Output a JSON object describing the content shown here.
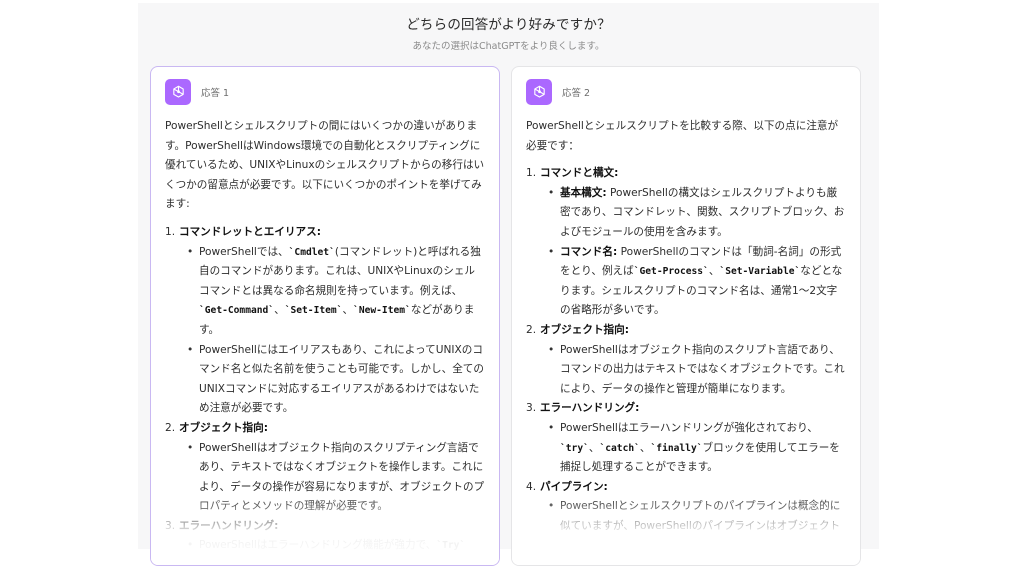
{
  "header": {
    "question": "どちらの回答がより好みですか？",
    "subtitle": "あなたの選択はChatGPTをより良くします。"
  },
  "icons": {
    "logo": "openai-logo-icon",
    "logo_bg": "#ab68ff"
  },
  "response1": {
    "label": "応答 1",
    "intro": "PowerShellとシェルスクリプトの間にはいくつかの違いがあります。PowerShellはWindows環境での自動化とスクリプティングに優れているため、UNIXやLinuxのシェルスクリプトからの移行はいくつかの留意点が必要です。以下にいくつかのポイントを挙げてみます:",
    "s1": {
      "num": "1.",
      "title": "コマンドレットとエイリアス:",
      "b1": {
        "t1": "PowerShellでは、",
        "c1": "`Cmdlet`",
        "t2": "(コマンドレット)と呼ばれる独自のコマンドがあります。これは、UNIXやLinuxのシェルコマンドとは異なる命名規則を持っています。例えば、",
        "c2": "`Get-Command`",
        "t3": "、",
        "c3": "`Set-Item`",
        "t4": "、",
        "c4": "`New-Item`",
        "t5": "などがあります。"
      },
      "b2": "PowerShellにはエイリアスもあり、これによってUNIXのコマンド名と似た名前を使うことも可能です。しかし、全てのUNIXコマンドに対応するエイリアスがあるわけではないため注意が必要です。"
    },
    "s2": {
      "num": "2.",
      "title": "オブジェクト指向:",
      "b1": "PowerShellはオブジェクト指向のスクリプティング言語であり、テキストではなくオブジェクトを操作します。これにより、データの操作が容易になりますが、オブジェクトのプロパティとメソッドの理解が必要です。"
    },
    "s3": {
      "num": "3.",
      "title": "エラーハンドリング:",
      "b1": {
        "t1": "PowerShellはエラーハンドリング機能が強力で、",
        "c1": "`Try`"
      }
    }
  },
  "response2": {
    "label": "応答 2",
    "intro": "PowerShellとシェルスクリプトを比較する際、以下の点に注意が必要です：",
    "s1": {
      "num": "1.",
      "title": "コマンドと構文:",
      "b1": {
        "k": "基本構文:",
        "t": " PowerShellの構文はシェルスクリプトよりも厳密であり、コマンドレット、関数、スクリプトブロック、およびモジュールの使用を含みます。"
      },
      "b2": {
        "k": "コマンド名:",
        "t1": " PowerShellのコマンドは「動詞-名詞」の形式をとり、例えば",
        "c1": "`Get-Process`",
        "t2": "、",
        "c2": "`Set-Variable`",
        "t3": "などとなります。シェルスクリプトのコマンド名は、通常1〜2文字の省略形が多いです。"
      }
    },
    "s2": {
      "num": "2.",
      "title": "オブジェクト指向:",
      "b1": "PowerShellはオブジェクト指向のスクリプト言語であり、コマンドの出力はテキストではなくオブジェクトです。これにより、データの操作と管理が簡単になります。"
    },
    "s3": {
      "num": "3.",
      "title": "エラーハンドリング:",
      "b1": {
        "t1": "PowerShellはエラーハンドリングが強化されており、",
        "c1": "`try`",
        "t2": "、",
        "c2": "`catch`",
        "t3": "、",
        "c3": "`finally`",
        "t4": "ブロックを使用してエラーを捕捉し処理することができます。"
      }
    },
    "s4": {
      "num": "4.",
      "title": "パイプライン:",
      "b1": "PowerShellとシェルスクリプトのパイプラインは概念的に似ていますが、PowerShellのパイプラインはオブジェクト"
    }
  }
}
